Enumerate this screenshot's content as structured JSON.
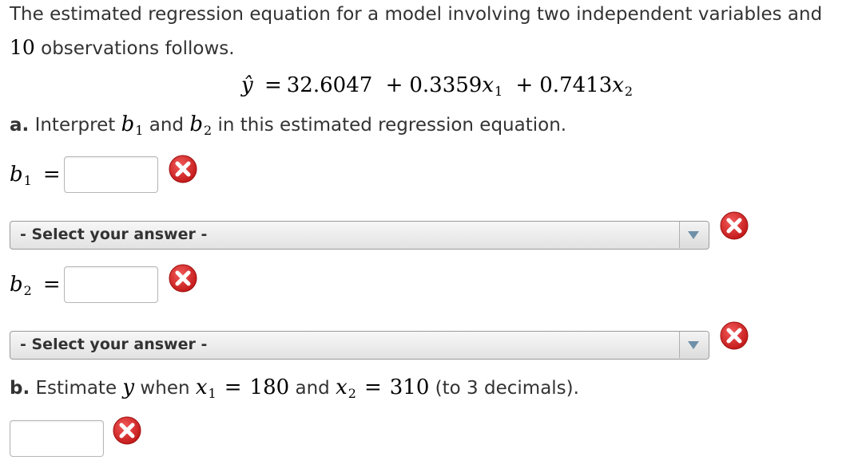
{
  "intro": {
    "line1": "The estimated regression equation for a model involving two independent variables and",
    "line2_num": "10",
    "line2_rest": " observations follows."
  },
  "equation": {
    "lhs": "ŷ",
    "eq": "=",
    "b0": "32.6047",
    "plus": "+",
    "b1": "0.3359",
    "b2": "0.7413",
    "var": "x",
    "sub1": "1",
    "sub2": "2"
  },
  "part_a": {
    "prefix": "a.",
    "text1": " Interpret ",
    "b1_var": "b",
    "b1_sub": "1",
    "and": " and ",
    "b2_var": "b",
    "b2_sub": "2",
    "text2": " in this estimated regression equation."
  },
  "b1_row": {
    "var": "b",
    "sub": "1",
    "eq": "=",
    "value": ""
  },
  "b2_row": {
    "var": "b",
    "sub": "2",
    "eq": "=",
    "value": ""
  },
  "select1": {
    "selected": "- Select your answer -"
  },
  "select2": {
    "selected": "- Select your answer -"
  },
  "part_b": {
    "prefix": "b.",
    "text1": " Estimate ",
    "y": "y",
    "when": " when ",
    "x": "x",
    "sub1": "1",
    "eq": "=",
    "val1": "180",
    "and": " and ",
    "sub2": "2",
    "val2": "310",
    "tail": " (to 3 decimals)."
  },
  "estimate_input": {
    "value": ""
  },
  "colors": {
    "x_icon_red": "#d42020",
    "text": "#333333"
  }
}
